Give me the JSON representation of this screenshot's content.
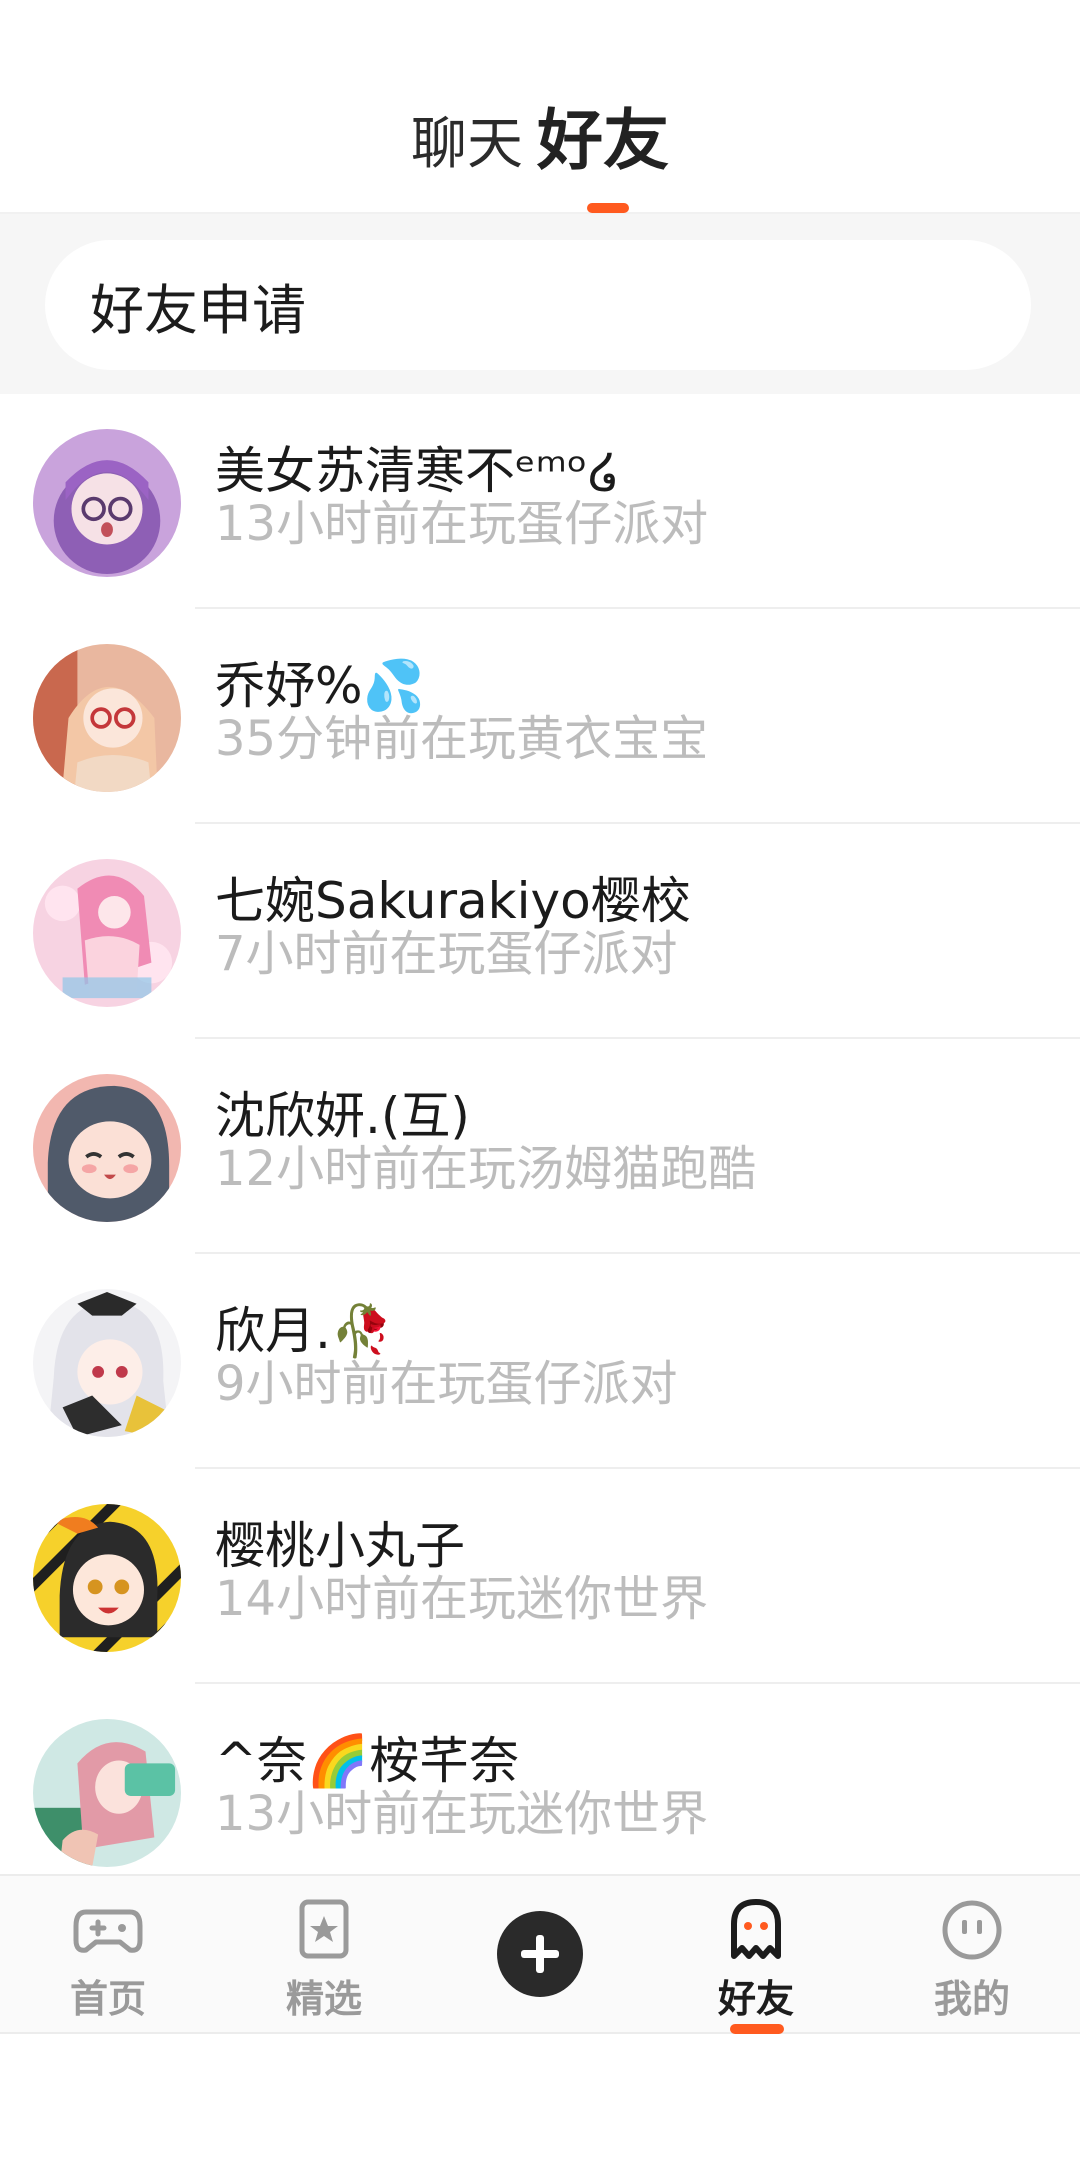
{
  "header": {
    "tabs": [
      {
        "label": "聊天",
        "active": false
      },
      {
        "label": "好友",
        "active": true
      }
    ],
    "accent_color": "#ff5a1f"
  },
  "friend_request": {
    "label": "好友申请"
  },
  "friends": [
    {
      "name": "美女苏清寒不ᵉᵐᵒ໒",
      "status": "13小时前在玩蛋仔派对",
      "avatar_icon": "anime-girl-purple-avatar"
    },
    {
      "name": "乔妤%💦",
      "status": "35分钟前在玩黄衣宝宝",
      "avatar_icon": "anime-girl-glasses-avatar"
    },
    {
      "name": "七婉Sakurakiyo樱校",
      "status": "7小时前在玩蛋仔派对",
      "avatar_icon": "anime-girl-pink-avatar"
    },
    {
      "name": "沈欣妍.(互)",
      "status": "12小时前在玩汤姆猫跑酷",
      "avatar_icon": "anime-girl-dark-hair-avatar"
    },
    {
      "name": "欣月.🥀",
      "status": "9小时前在玩蛋仔派对",
      "avatar_icon": "anime-girl-white-hair-avatar"
    },
    {
      "name": "樱桃小丸子",
      "status": "14小时前在玩迷你世界",
      "avatar_icon": "anime-girl-yellow-avatar"
    },
    {
      "name": "^奈🌈桉芊奈",
      "status": "13小时前在玩迷你世界",
      "avatar_icon": "anime-girl-pink-hair-avatar"
    }
  ],
  "bottom_nav": {
    "items": [
      {
        "label": "首页",
        "icon": "gamepad-icon",
        "active": false
      },
      {
        "label": "精选",
        "icon": "star-bookmark-icon",
        "active": false
      },
      {
        "label": "",
        "icon": "plus-icon",
        "active": false
      },
      {
        "label": "好友",
        "icon": "ghost-icon",
        "active": true
      },
      {
        "label": "我的",
        "icon": "smiley-face-icon",
        "active": false
      }
    ]
  }
}
